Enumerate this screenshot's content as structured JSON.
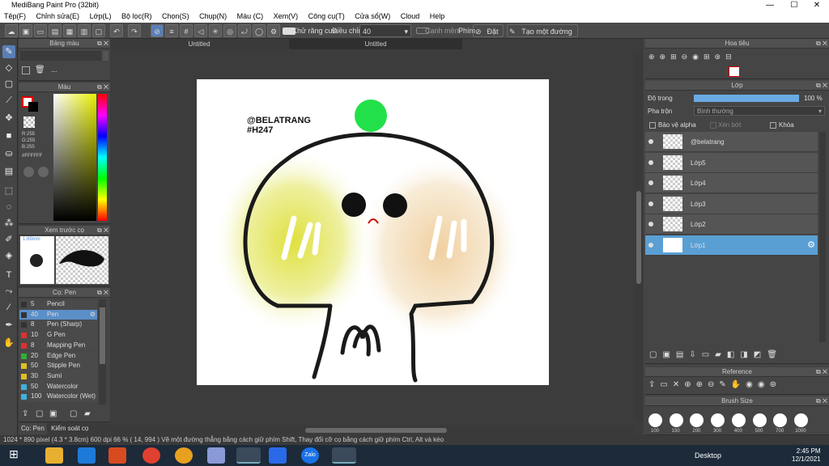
{
  "window": {
    "title": "MediBang Paint Pro (32bit)",
    "minimize": "—",
    "maximize": "☐",
    "close": "✕"
  },
  "menu": [
    "Tệp(F)",
    "Chỉnh sửa(E)",
    "Lớp(L)",
    "Bộ lọc(R)",
    "Chọn(S)",
    "Chụp(N)",
    "Màu (C)",
    "Xem(V)",
    "Công cụ(T)",
    "Cửa sổ(W)",
    "Cloud",
    "Help"
  ],
  "toolbar": {
    "antialias_label": "Khử răng cưa",
    "adjust_label": "Điều chỉnh",
    "adjust_value": "40",
    "edge_label": "Cạnh mềm",
    "key_label": "Phím",
    "reset_label": "Đặt lại",
    "line_label": "Tạo một đường thẳng"
  },
  "doc_tabs": [
    "Untitled",
    "Untitled"
  ],
  "panels": {
    "palette_title": "Bảng màu",
    "palette_more": "...",
    "color_title": "Màu",
    "rgb": {
      "r": "R:255",
      "g": "G:255",
      "b": "B:255",
      "hex": "#FFFFFF"
    },
    "preview_title": "Xem trước cọ",
    "preview_size": "1.69mm",
    "brush_title": "Cọ: Pen",
    "navigator_title": "Hoa tiêu",
    "layer_title": "Lớp",
    "opacity_label": "Độ trong",
    "opacity_value": "100 %",
    "opacity_fraction": 1.0,
    "blend_label": "Pha trộn",
    "blend_value": "Bình thường",
    "protect_alpha": "Bảo vệ alpha",
    "clipping": "Xén bớt",
    "lock": "Khóa",
    "reference_title": "Reference",
    "brushsize_title": "Brush Size",
    "bottom_tab_pen": "Cọ: Pen",
    "bottom_tab_brush_ctrl": "Kiểm soát cọ"
  },
  "brushes": [
    {
      "size": "5",
      "name": "Pencil",
      "color": "#333333"
    },
    {
      "size": "40",
      "name": "Pen",
      "color": "#333333",
      "selected": true
    },
    {
      "size": "8",
      "name": "Pen (Sharp)",
      "color": "#333333"
    },
    {
      "size": "10",
      "name": "G Pen",
      "color": "#e03030"
    },
    {
      "size": "8",
      "name": "Mapping Pen",
      "color": "#e03030"
    },
    {
      "size": "20",
      "name": "Edge Pen",
      "color": "#30b030"
    },
    {
      "size": "50",
      "name": "Stipple Pen",
      "color": "#e0c020"
    },
    {
      "size": "30",
      "name": "Sumi",
      "color": "#e0c020"
    },
    {
      "size": "50",
      "name": "Watercolor",
      "color": "#40b0e0"
    },
    {
      "size": "100",
      "name": "Watercolor (Wet)",
      "color": "#40b0e0"
    }
  ],
  "layers": [
    {
      "name": "@belatrang",
      "selected": false
    },
    {
      "name": "Lớp5",
      "selected": false
    },
    {
      "name": "Lớp4",
      "selected": false
    },
    {
      "name": "Lớp3",
      "selected": false
    },
    {
      "name": "Lớp2",
      "selected": false
    },
    {
      "name": "Lớp1",
      "selected": true
    }
  ],
  "brush_sizes": [
    "100",
    "150",
    "200",
    "300",
    "400",
    "500",
    "700",
    "1000"
  ],
  "artwork": {
    "handle": "@BELATRANG",
    "tag": "#H247"
  },
  "status": {
    "text": "1024 * 890 pixel  (4.3 * 3.8cm)  600 dpi  66 %  ( 14, 994 )  Vẽ một đường thẳng bằng cách giữ phím Shift, Thay đổi cỡ cọ bằng cách giữ phím Ctrl, Alt và kéo"
  },
  "taskbar": {
    "desktop": "Desktop",
    "time": "2:45 PM",
    "date": "12/1/2021",
    "zalo": "Zalo"
  },
  "colors": {
    "accent": "#5a9fd4",
    "selected_brush": "#5a8fc8"
  }
}
